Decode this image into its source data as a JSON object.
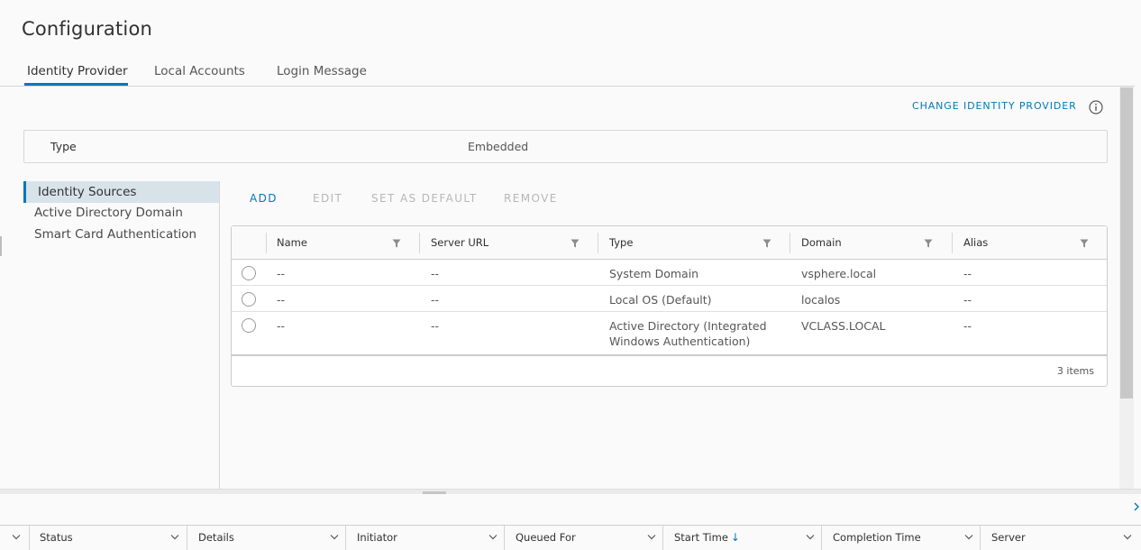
{
  "page": {
    "title": "Configuration"
  },
  "tabs": [
    {
      "label": "Identity Provider",
      "active": true
    },
    {
      "label": "Local Accounts",
      "active": false
    },
    {
      "label": "Login Message",
      "active": false
    }
  ],
  "toolbar": {
    "change_identity_provider": "CHANGE IDENTITY PROVIDER",
    "info_icon": "info-circle-icon"
  },
  "type_row": {
    "label": "Type",
    "value": "Embedded"
  },
  "side_nav": [
    {
      "label": "Identity Sources",
      "active": true
    },
    {
      "label": "Active Directory Domain",
      "active": false
    },
    {
      "label": "Smart Card Authentication",
      "active": false
    }
  ],
  "actions": [
    {
      "label": "ADD",
      "enabled": true
    },
    {
      "label": "EDIT",
      "enabled": false
    },
    {
      "label": "SET AS DEFAULT",
      "enabled": false
    },
    {
      "label": "REMOVE",
      "enabled": false
    }
  ],
  "grid": {
    "columns": [
      "Name",
      "Server URL",
      "Type",
      "Domain",
      "Alias"
    ],
    "rows": [
      {
        "name": "--",
        "server_url": "--",
        "type": "System Domain",
        "type_line2": "",
        "domain": "vsphere.local",
        "alias": "--"
      },
      {
        "name": "--",
        "server_url": "--",
        "type": "Local OS (Default)",
        "type_line2": "",
        "domain": "localos",
        "alias": "--"
      },
      {
        "name": "--",
        "server_url": "--",
        "type": "Active Directory (Integrated",
        "type_line2": "Windows Authentication)",
        "domain": "VCLASS.LOCAL",
        "alias": "--"
      }
    ],
    "footer": "3 items"
  },
  "recent_tasks": {
    "columns": [
      "Status",
      "Details",
      "Initiator",
      "Queued For",
      "Start Time",
      "Completion Time",
      "Server"
    ],
    "sorted_column": "Start Time",
    "sort_direction": "descending"
  },
  "colors": {
    "accent": "#0079b8",
    "disabled": "#b7b7b7",
    "active_nav_bg": "#d8e3e9"
  }
}
